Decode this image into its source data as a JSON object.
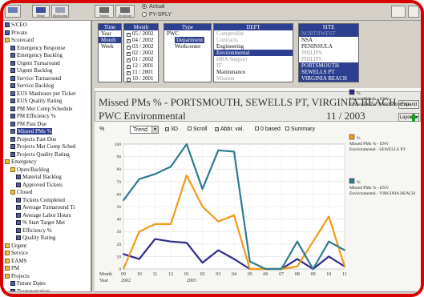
{
  "toolbar": {
    "buttons": [
      {
        "name": "home-button",
        "label": "Home"
      },
      {
        "name": "monitoring-button",
        "label": "Monitoring"
      },
      {
        "name": "submit-button",
        "label": "Submit"
      },
      {
        "name": "download-button",
        "label": "Download"
      }
    ],
    "radios": [
      {
        "label": "Actual",
        "selected": true
      },
      {
        "label": "FY-SPLY",
        "selected": false
      }
    ]
  },
  "sidebar": {
    "items": [
      {
        "label": "S/CEO",
        "icon": "doc",
        "indent": 0
      },
      {
        "label": "Private",
        "icon": "doc",
        "indent": 0
      },
      {
        "label": "Scorecard",
        "icon": "fold",
        "indent": 0
      },
      {
        "label": "Emergency Response",
        "icon": "doc",
        "indent": 1
      },
      {
        "label": "Emergency Backlog",
        "icon": "doc",
        "indent": 1
      },
      {
        "label": "Urgent Turnaround",
        "icon": "doc",
        "indent": 1
      },
      {
        "label": "Urgent Backlog",
        "icon": "doc",
        "indent": 1
      },
      {
        "label": "Service Turnaround",
        "icon": "doc",
        "indent": 1
      },
      {
        "label": "Service Backlog",
        "icon": "doc",
        "indent": 1
      },
      {
        "label": "EUS Manhours per Ticket",
        "icon": "doc",
        "indent": 1
      },
      {
        "label": "EUS Quality Rating",
        "icon": "doc",
        "indent": 1
      },
      {
        "label": "PM Met Comp Schedule",
        "icon": "doc",
        "indent": 1
      },
      {
        "label": "PM Efficiency %",
        "icon": "doc",
        "indent": 1
      },
      {
        "label": "PM Past Due",
        "icon": "doc",
        "indent": 1
      },
      {
        "label": "Missed PMs %",
        "icon": "doc",
        "indent": 1,
        "selected": true
      },
      {
        "label": "Projects Past Due",
        "icon": "doc",
        "indent": 1
      },
      {
        "label": "Projects Met Comp Sched",
        "icon": "doc",
        "indent": 1
      },
      {
        "label": "Projects Quality Rating",
        "icon": "doc",
        "indent": 1
      },
      {
        "label": "Emergency",
        "icon": "fold",
        "indent": 0
      },
      {
        "label": "Open/Backlog",
        "icon": "fold",
        "indent": 1
      },
      {
        "label": "Material Backlog",
        "icon": "doc",
        "indent": 2
      },
      {
        "label": "Approved Tickets",
        "icon": "doc",
        "indent": 2
      },
      {
        "label": "Closed",
        "icon": "fold",
        "indent": 1
      },
      {
        "label": "Tickets Completed",
        "icon": "doc",
        "indent": 2
      },
      {
        "label": "Average Turnaround Ti",
        "icon": "doc",
        "indent": 2
      },
      {
        "label": "Average Labor Hours",
        "icon": "doc",
        "indent": 2
      },
      {
        "label": "% Start Target Met",
        "icon": "doc",
        "indent": 2
      },
      {
        "label": "Efficiency %",
        "icon": "doc",
        "indent": 2
      },
      {
        "label": "Quality Rating",
        "icon": "doc",
        "indent": 2
      },
      {
        "label": "Urgent",
        "icon": "fold",
        "indent": 0
      },
      {
        "label": "Service",
        "icon": "fold",
        "indent": 0
      },
      {
        "label": "EAMS",
        "icon": "fold",
        "indent": 0
      },
      {
        "label": "PM",
        "icon": "fold",
        "indent": 0
      },
      {
        "label": "Projects",
        "icon": "fold",
        "indent": 0
      },
      {
        "label": "Future Dates",
        "icon": "doc",
        "indent": 1
      },
      {
        "label": "Transportation",
        "icon": "doc",
        "indent": 1
      }
    ]
  },
  "filters": {
    "time": {
      "header": "Time",
      "items": [
        {
          "label": "Year",
          "sel": false
        },
        {
          "label": "Month",
          "sel": true
        },
        {
          "label": "Week",
          "sel": false
        }
      ]
    },
    "month": {
      "header": "Month",
      "items": [
        "05 / 2002",
        "04 / 2002",
        "03 / 2002",
        "02 / 2002",
        "01 / 2002",
        "12 / 2001",
        "11 / 2001",
        "10 / 2001"
      ]
    },
    "type": {
      "header": "Type",
      "items": [
        {
          "label": "PWC",
          "sel": false,
          "indent": 0
        },
        {
          "label": "Department",
          "sel": true,
          "indent": 1
        },
        {
          "label": "Workcenter",
          "sel": false,
          "indent": 1
        }
      ]
    },
    "dept": {
      "header": "DEPT",
      "items": [
        {
          "label": "Comptroller",
          "st": "dim"
        },
        {
          "label": "Contracts",
          "st": "dim"
        },
        {
          "label": "Engineering",
          "st": ""
        },
        {
          "label": "Environmental",
          "st": "sel"
        },
        {
          "label": "HRA Support",
          "st": "dim"
        },
        {
          "label": "IT",
          "st": "dim"
        },
        {
          "label": "Maintenance",
          "st": ""
        },
        {
          "label": "Mission",
          "st": "dim"
        }
      ]
    },
    "site": {
      "header": "SITE",
      "items": [
        {
          "label": "NORTHWEST",
          "st": "dimsel"
        },
        {
          "label": "NSA",
          "st": ""
        },
        {
          "label": "PENINSULA",
          "st": ""
        },
        {
          "label": "PHILIPS",
          "st": "dim"
        },
        {
          "label": "PHILIPS",
          "st": "dim"
        },
        {
          "label": "PORTSMOUTH",
          "st": "sel"
        },
        {
          "label": "SEWELLS PT",
          "st": "sel"
        },
        {
          "label": "VIRGINIA BEACH",
          "st": "sel"
        }
      ]
    }
  },
  "chart_header": {
    "title": "Missed PMs %  -  PORTSMOUTH, SEWELLS PT, VIRGINIA BEACH",
    "subtitle": "PWC Environmental",
    "date": "11 / 2003",
    "expand_label": "Expand",
    "layout_label": "Layout"
  },
  "options": {
    "unit": "%",
    "trend_value": "Trend",
    "checks": [
      {
        "label": "3D",
        "on": true
      },
      {
        "label": "Scroll",
        "on": false
      },
      {
        "label": "Abbr. val.",
        "on": true
      },
      {
        "label": "0 based",
        "on": false
      },
      {
        "label": "Summary",
        "on": false
      }
    ]
  },
  "chart_data": {
    "type": "line",
    "x": [
      "09",
      "10",
      "11",
      "12",
      "01",
      "02",
      "03",
      "04",
      "05",
      "06",
      "07",
      "08",
      "09",
      "10",
      "11"
    ],
    "year_labels": [
      {
        "at": "09",
        "label": "2002"
      },
      {
        "at": "01",
        "label": "2003"
      }
    ],
    "xlabel_prefix": [
      "Month",
      "Year"
    ],
    "ylim": [
      0,
      100
    ],
    "yticks": [
      0,
      10,
      20,
      30,
      40,
      50,
      60,
      70,
      80,
      90,
      100
    ],
    "grid": true,
    "series": [
      {
        "name": "Missed PMs % - ENV Environmental - PORTSMOUTH",
        "legend_lines": [
          "%",
          "Missed PMs % - ENV",
          "Environmental - PORTSMOUTH"
        ],
        "color": "#2e2a8c",
        "values": [
          12,
          8,
          24,
          22,
          21,
          5,
          15,
          8,
          0,
          0,
          0,
          8,
          0,
          10,
          2
        ]
      },
      {
        "name": "Missed PMs % - ENV Environmental - SEWELLS PT",
        "legend_lines": [
          "%",
          "Missed PMs % - ENV",
          "Environmental - SEWELLS PT"
        ],
        "color": "#f29a18",
        "values": [
          0,
          30,
          36,
          36,
          75,
          50,
          38,
          43,
          0,
          0,
          0,
          2,
          22,
          42,
          2
        ]
      },
      {
        "name": "Missed PMs % - ENV Environmental - VIRGINIA BEACH",
        "legend_lines": [
          "%",
          "Missed PMs % - ENV",
          "Environmental - VIRGINIA BEACH"
        ],
        "color": "#2f7a8e",
        "values": [
          55,
          72,
          76,
          82,
          100,
          64,
          95,
          94,
          6,
          0,
          0,
          22,
          0,
          22,
          15
        ]
      }
    ]
  }
}
